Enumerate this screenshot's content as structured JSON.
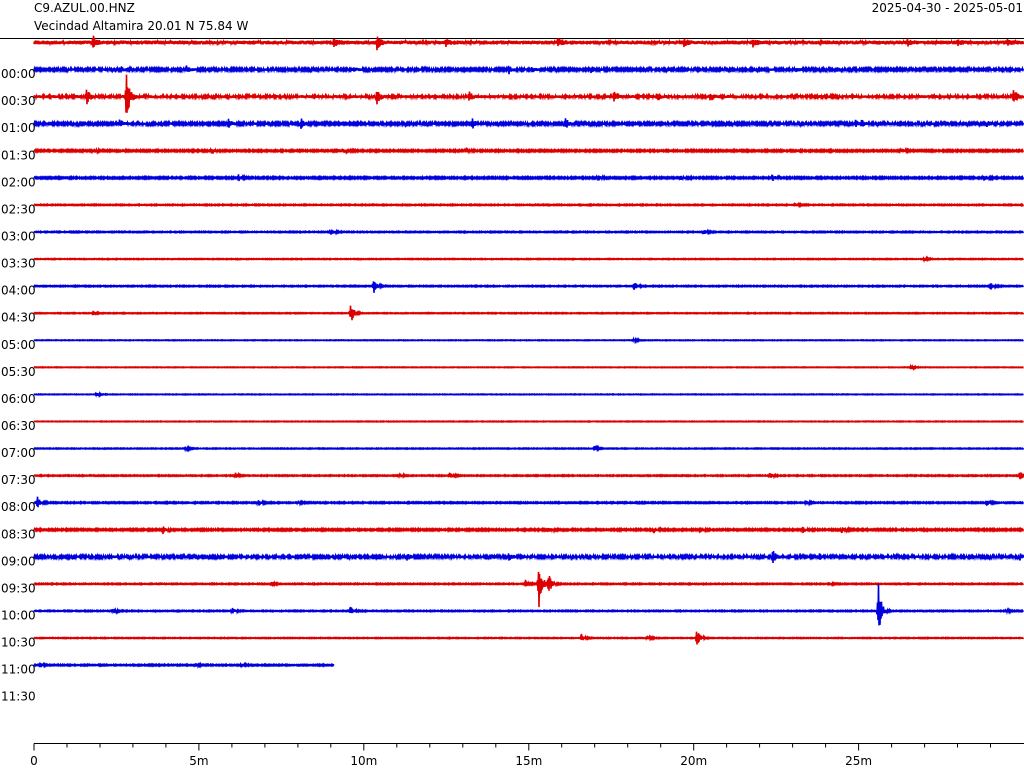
{
  "header": {
    "station": "C9.AZUL.00.HNZ",
    "place": "Vecindad Altamira  20.01 N 75.84 W",
    "date_range": "2025-04-30 - 2025-05-01"
  },
  "colors": {
    "odd_trace": "#dd0000",
    "even_trace": "#0000dd",
    "axis": "#000000"
  },
  "chart_data": {
    "type": "line",
    "title": "",
    "xlabel": "",
    "ylabel": "",
    "x_ticks": [
      "0",
      "5m",
      "10m",
      "15m",
      "20m",
      "25m"
    ],
    "x_tick_values_min": [
      0,
      5,
      10,
      15,
      20,
      25
    ],
    "xlim_min": [
      0,
      30
    ],
    "minor_tick_step_min": 1,
    "line_minutes": 30,
    "y_labels": [
      "00:00",
      "00:30",
      "01:00",
      "01:30",
      "02:00",
      "02:30",
      "03:00",
      "03:30",
      "04:00",
      "04:30",
      "05:00",
      "05:30",
      "06:00",
      "06:30",
      "07:00",
      "07:30",
      "08:00",
      "08:30",
      "09:00",
      "09:30",
      "10:00",
      "10:30",
      "11:00",
      "11:30"
    ],
    "traces": [
      {
        "color": "red",
        "minutes": 30,
        "noise": 2,
        "events": [
          [
            1.8,
            5
          ],
          [
            9.1,
            3
          ],
          [
            10.4,
            6
          ],
          [
            12.5,
            3
          ],
          [
            15.9,
            5
          ],
          [
            19.7,
            3
          ],
          [
            21.8,
            3
          ],
          [
            26.5,
            3
          ],
          [
            28,
            2
          ],
          [
            29.5,
            3
          ]
        ]
      },
      {
        "color": "blue",
        "minutes": 30,
        "noise": 1.2,
        "events": [
          [
            2.6,
            4
          ],
          [
            4.6,
            4
          ],
          [
            9.7,
            2
          ],
          [
            14.4,
            4
          ],
          [
            15.1,
            2
          ],
          [
            16.9,
            3
          ],
          [
            23.1,
            2
          ],
          [
            24.3,
            3
          ]
        ]
      },
      {
        "color": "red",
        "minutes": 30,
        "noise": 1.5,
        "events": [
          [
            1.6,
            7
          ],
          [
            2.8,
            27
          ],
          [
            10.4,
            7
          ],
          [
            13.2,
            4
          ],
          [
            17.6,
            6
          ],
          [
            18.9,
            4
          ],
          [
            20.5,
            4
          ],
          [
            29.7,
            9
          ]
        ]
      },
      {
        "color": "blue",
        "minutes": 30,
        "noise": 1.2,
        "events": [
          [
            2.6,
            4
          ],
          [
            5.9,
            4
          ],
          [
            8.1,
            5
          ],
          [
            13.3,
            5
          ],
          [
            16.1,
            6
          ],
          [
            24.9,
            3
          ],
          [
            25.1,
            3
          ],
          [
            28.9,
            3
          ]
        ]
      },
      {
        "color": "red",
        "minutes": 30,
        "noise": 0.8,
        "events": [
          [
            1.8,
            2
          ],
          [
            5.4,
            3
          ],
          [
            9.4,
            2
          ],
          [
            13.1,
            3
          ],
          [
            26.3,
            2
          ]
        ]
      },
      {
        "color": "blue",
        "minutes": 30,
        "noise": 0.8,
        "events": [
          [
            6.2,
            3
          ],
          [
            17.1,
            3
          ],
          [
            19.6,
            3
          ],
          [
            22.4,
            3
          ],
          [
            28.8,
            3
          ]
        ]
      },
      {
        "color": "red",
        "minutes": 30,
        "noise": 0.5,
        "events": [
          [
            23.1,
            2
          ]
        ]
      },
      {
        "color": "blue",
        "minutes": 30,
        "noise": 0.5,
        "events": [
          [
            9.0,
            4
          ],
          [
            20.3,
            3
          ]
        ]
      },
      {
        "color": "red",
        "minutes": 30,
        "noise": 0.4,
        "events": [
          [
            27.0,
            2
          ]
        ]
      },
      {
        "color": "blue",
        "minutes": 30,
        "noise": 0.5,
        "events": [
          [
            10.3,
            7
          ],
          [
            18.2,
            4
          ],
          [
            29.0,
            4
          ]
        ]
      },
      {
        "color": "red",
        "minutes": 30,
        "noise": 0.4,
        "events": [
          [
            1.8,
            2
          ],
          [
            9.6,
            11
          ]
        ]
      },
      {
        "color": "blue",
        "minutes": 30,
        "noise": 0.3,
        "events": [
          [
            18.2,
            2
          ]
        ]
      },
      {
        "color": "red",
        "minutes": 30,
        "noise": 0.3,
        "events": [
          [
            26.6,
            2
          ]
        ]
      },
      {
        "color": "blue",
        "minutes": 30,
        "noise": 0.3,
        "events": [
          [
            1.9,
            2
          ]
        ]
      },
      {
        "color": "red",
        "minutes": 30,
        "noise": 0.3,
        "events": []
      },
      {
        "color": "blue",
        "minutes": 30,
        "noise": 0.4,
        "events": [
          [
            4.6,
            2
          ],
          [
            17.0,
            3
          ]
        ]
      },
      {
        "color": "red",
        "minutes": 30,
        "noise": 0.5,
        "events": [
          [
            6.1,
            3
          ],
          [
            11.1,
            2
          ],
          [
            12.6,
            3
          ],
          [
            22.3,
            3
          ],
          [
            29.9,
            5
          ]
        ]
      },
      {
        "color": "blue",
        "minutes": 30,
        "noise": 0.6,
        "events": [
          [
            0.1,
            6
          ],
          [
            6.8,
            3
          ],
          [
            8.0,
            2
          ],
          [
            23.4,
            2
          ],
          [
            28.9,
            3
          ]
        ]
      },
      {
        "color": "red",
        "minutes": 30,
        "noise": 0.8,
        "events": [
          [
            3.9,
            4
          ],
          [
            15.6,
            3
          ],
          [
            18.8,
            3
          ],
          [
            20.2,
            3
          ],
          [
            23.3,
            3
          ],
          [
            24.5,
            3
          ]
        ]
      },
      {
        "color": "blue",
        "minutes": 30,
        "noise": 1.3,
        "events": [
          [
            11.3,
            3
          ],
          [
            14.4,
            4
          ],
          [
            22.4,
            6
          ],
          [
            23.8,
            3
          ],
          [
            29.9,
            3
          ]
        ]
      },
      {
        "color": "red",
        "minutes": 30,
        "noise": 0.5,
        "events": [
          [
            7.2,
            2
          ],
          [
            14.9,
            4
          ],
          [
            15.3,
            28
          ],
          [
            15.6,
            10
          ],
          [
            24.1,
            2
          ]
        ]
      },
      {
        "color": "blue",
        "minutes": 30,
        "noise": 0.5,
        "events": [
          [
            2.4,
            3
          ],
          [
            6.0,
            4
          ],
          [
            9.6,
            4
          ],
          [
            25.6,
            28
          ],
          [
            29.5,
            2
          ]
        ]
      },
      {
        "color": "red",
        "minutes": 30,
        "noise": 0.4,
        "events": [
          [
            16.6,
            4
          ],
          [
            18.6,
            3
          ],
          [
            20.1,
            9
          ]
        ]
      },
      {
        "color": "blue",
        "minutes": 9.1,
        "noise": 0.6,
        "events": [
          [
            0.2,
            2
          ],
          [
            4.9,
            2
          ],
          [
            6.3,
            2
          ]
        ]
      }
    ]
  }
}
